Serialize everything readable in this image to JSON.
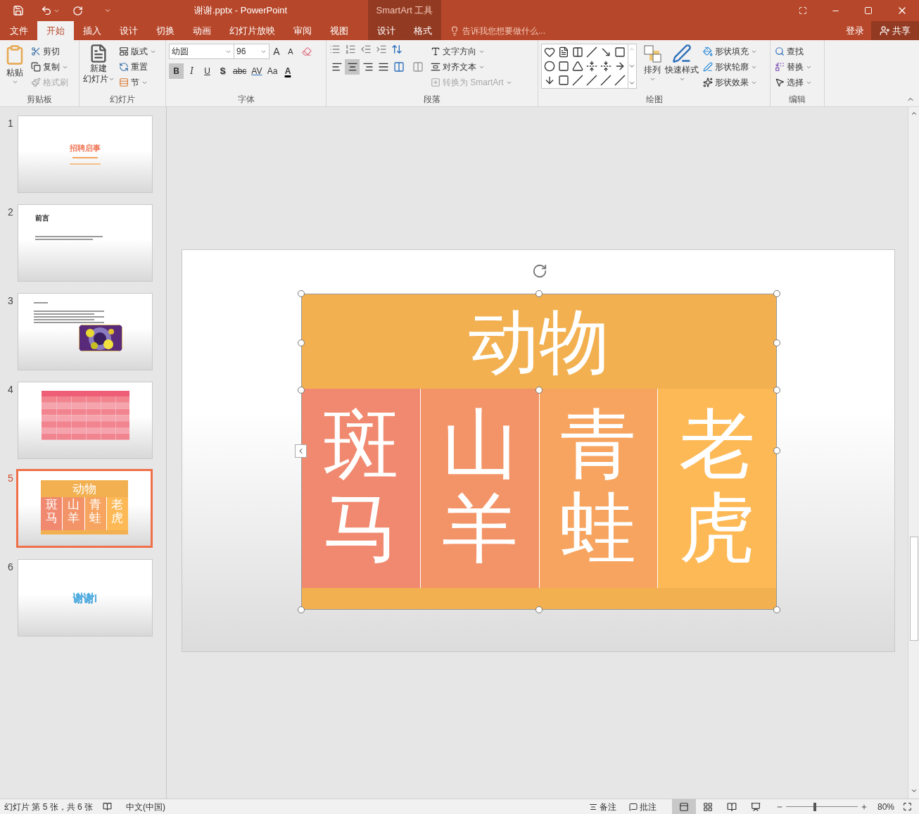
{
  "window": {
    "title": "谢谢.pptx - PowerPoint",
    "tool_group": "SmartArt 工具"
  },
  "tabs": [
    {
      "label": "文件",
      "selected": false,
      "kind": "normal"
    },
    {
      "label": "开始",
      "selected": true,
      "kind": "normal"
    },
    {
      "label": "插入",
      "selected": false,
      "kind": "normal"
    },
    {
      "label": "设计",
      "selected": false,
      "kind": "normal"
    },
    {
      "label": "切换",
      "selected": false,
      "kind": "normal"
    },
    {
      "label": "动画",
      "selected": false,
      "kind": "normal"
    },
    {
      "label": "幻灯片放映",
      "selected": false,
      "kind": "normal"
    },
    {
      "label": "审阅",
      "selected": false,
      "kind": "normal"
    },
    {
      "label": "视图",
      "selected": false,
      "kind": "normal"
    },
    {
      "label": "设计",
      "selected": false,
      "kind": "contextual"
    },
    {
      "label": "格式",
      "selected": false,
      "kind": "contextual"
    }
  ],
  "tell_me": {
    "placeholder": "告诉我您想要做什么..."
  },
  "account": {
    "sign_in": "登录",
    "share": "共享"
  },
  "ribbon": {
    "clipboard": {
      "label": "剪贴板",
      "paste": "粘贴",
      "cut": "剪切",
      "copy": "复制",
      "format_painter": {
        "label": "格式刷",
        "disabled": true
      }
    },
    "slides": {
      "label": "幻灯片",
      "new_slide": [
        "新建",
        "幻灯片"
      ],
      "layout": "版式",
      "reset": "重置",
      "section": "节"
    },
    "font": {
      "label": "字体",
      "font_name": "幼圆",
      "font_size": "96",
      "size_buttons": [
        {
          "label": "A",
          "kind": "grow"
        },
        {
          "label": "A",
          "kind": "shrink"
        }
      ],
      "format_buttons": [
        {
          "label": "B",
          "kind": "bold",
          "on": true
        },
        {
          "label": "I",
          "kind": "italic",
          "on": false
        },
        {
          "label": "U",
          "kind": "underline",
          "on": false
        },
        {
          "label": "S",
          "kind": "shadow",
          "on": false
        },
        {
          "label": "abc",
          "kind": "strike",
          "on": false
        },
        {
          "label": "AV",
          "kind": "spacing",
          "on": false
        },
        {
          "label": "Aa",
          "kind": "case",
          "on": false
        },
        {
          "label": "A",
          "kind": "color",
          "on": false
        }
      ]
    },
    "paragraph": {
      "label": "段落",
      "text_direction": "文字方向",
      "align_text": "对齐文本",
      "convert": {
        "label": "转换为 SmartArt",
        "disabled": true
      },
      "alignments": [
        {
          "kind": "left",
          "selected": false
        },
        {
          "kind": "center",
          "selected": true
        },
        {
          "kind": "right",
          "selected": false
        },
        {
          "kind": "justify",
          "selected": false
        },
        {
          "kind": "distributed",
          "selected": false
        }
      ]
    },
    "drawing": {
      "label": "绘图",
      "arrange": "排列",
      "quick_styles": "快速样式",
      "shape_fill": "形状填充",
      "shape_outline": "形状轮廓",
      "shape_effects": "形状效果"
    },
    "editing": {
      "label": "编辑",
      "find": "查找",
      "replace": "替换",
      "select": "选择"
    }
  },
  "slides": [
    {
      "number": "1",
      "selected": false,
      "kind": "title",
      "title": "招聘启事"
    },
    {
      "number": "2",
      "selected": false,
      "kind": "heading",
      "title": "前言"
    },
    {
      "number": "3",
      "selected": false,
      "kind": "text_picture"
    },
    {
      "number": "4",
      "selected": false,
      "kind": "table"
    },
    {
      "number": "5",
      "selected": true,
      "kind": "smartart",
      "header": "动物",
      "cells": [
        {
          "text": "斑马",
          "color": "#f0896f"
        },
        {
          "text": "山羊",
          "color": "#f39468"
        },
        {
          "text": "青蛙",
          "color": "#f6a45f"
        },
        {
          "text": "老虎",
          "color": "#fdb956"
        }
      ]
    },
    {
      "number": "6",
      "selected": false,
      "kind": "closing",
      "title": "谢谢!"
    }
  ],
  "smartart": {
    "header": "动物",
    "cells": [
      {
        "text": "斑马",
        "color": "#f0896f"
      },
      {
        "text": "山羊",
        "color": "#f39468"
      },
      {
        "text": "青蛙",
        "color": "#f6a45f"
      },
      {
        "text": "老虎",
        "color": "#fdb956"
      }
    ]
  },
  "status_bar": {
    "slide_info": "幻灯片 第 5 张，共 6 张",
    "language": "中文(中国)",
    "notes": "备注",
    "comments": "批注",
    "views": [
      {
        "kind": "normal",
        "selected": true
      },
      {
        "kind": "sorter",
        "selected": false
      },
      {
        "kind": "reading",
        "selected": false
      },
      {
        "kind": "show",
        "selected": false
      }
    ],
    "zoom": {
      "level": 0.4
    },
    "zoom_text": "80%"
  }
}
